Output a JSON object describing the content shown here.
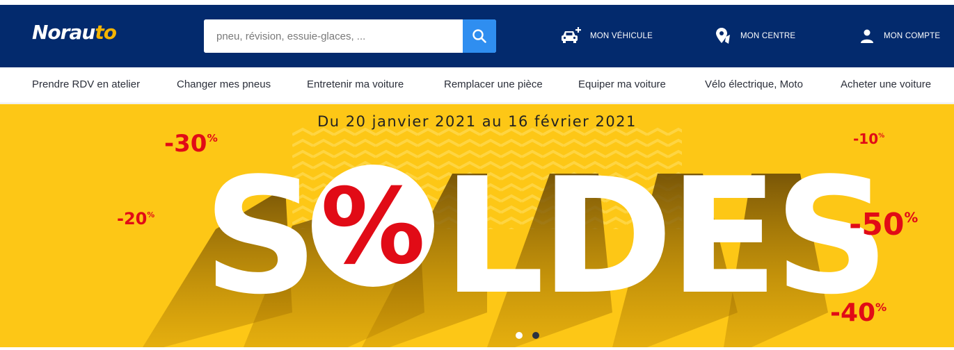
{
  "header": {
    "logo": {
      "text": "Norauto",
      "main": "Norau",
      "accent": "to"
    },
    "search": {
      "placeholder": "pneu, révision, essuie-glaces, ...",
      "value": ""
    },
    "nav": {
      "vehicle": {
        "label": "MON VÉHICULE",
        "icon": "car-add-icon"
      },
      "center": {
        "label": "MON CENTRE",
        "icon": "location-pin-icon"
      },
      "account": {
        "label": "MON COMPTE",
        "icon": "user-icon"
      }
    }
  },
  "menu": {
    "items": [
      {
        "label": "Prendre RDV en atelier"
      },
      {
        "label": "Changer mes pneus"
      },
      {
        "label": "Entretenir ma voiture"
      },
      {
        "label": "Remplacer une pièce"
      },
      {
        "label": "Equiper ma voiture"
      },
      {
        "label": "Vélo électrique, Moto"
      },
      {
        "label": "Acheter une voiture"
      }
    ]
  },
  "banner": {
    "date": "Du 20 janvier 2021 au 16 février 2021",
    "headline": {
      "before": "S",
      "after": "LDES",
      "percent": "%"
    },
    "discounts": [
      "-30",
      "-20",
      "-10",
      "-50",
      "-40"
    ],
    "percent_sign": "%",
    "slides": {
      "count": 2,
      "active": 1
    }
  },
  "colors": {
    "header_bg": "#032a6d",
    "logo_accent": "#f5b400",
    "search_button": "#2f8ef0",
    "banner_bg": "#fdc716",
    "discount_red": "#e10b16"
  }
}
